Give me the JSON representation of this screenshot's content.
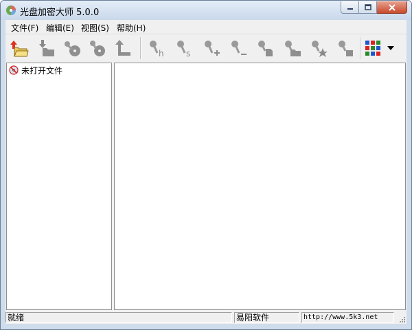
{
  "window": {
    "title": "光盘加密大师 5.0.0"
  },
  "menu": {
    "items": [
      "文件(F)",
      "编辑(E)",
      "视图(S)",
      "帮助(H)"
    ]
  },
  "toolbar": {
    "buttons": [
      {
        "icon": "open-file-icon"
      },
      {
        "icon": "import-icon"
      },
      {
        "icon": "disc-key-icon"
      },
      {
        "icon": "disc-key-alt-icon"
      },
      {
        "icon": "up-level-icon"
      },
      {
        "icon": "key-hide-icon"
      },
      {
        "icon": "key-s-icon"
      },
      {
        "icon": "key-add-icon"
      },
      {
        "icon": "key-remove-icon"
      },
      {
        "icon": "key-file-icon"
      },
      {
        "icon": "key-folder-icon"
      },
      {
        "icon": "key-star-icon"
      },
      {
        "icon": "key-block-icon"
      },
      {
        "icon": "view-grid-icon"
      }
    ],
    "dropdown_icon": "dropdown-arrow-icon"
  },
  "tree": {
    "root_label": "未打开文件",
    "root_icon": "no-disc-icon"
  },
  "status": {
    "state": "就绪",
    "company": "易阳软件",
    "url": "http://www.5k3.net"
  }
}
